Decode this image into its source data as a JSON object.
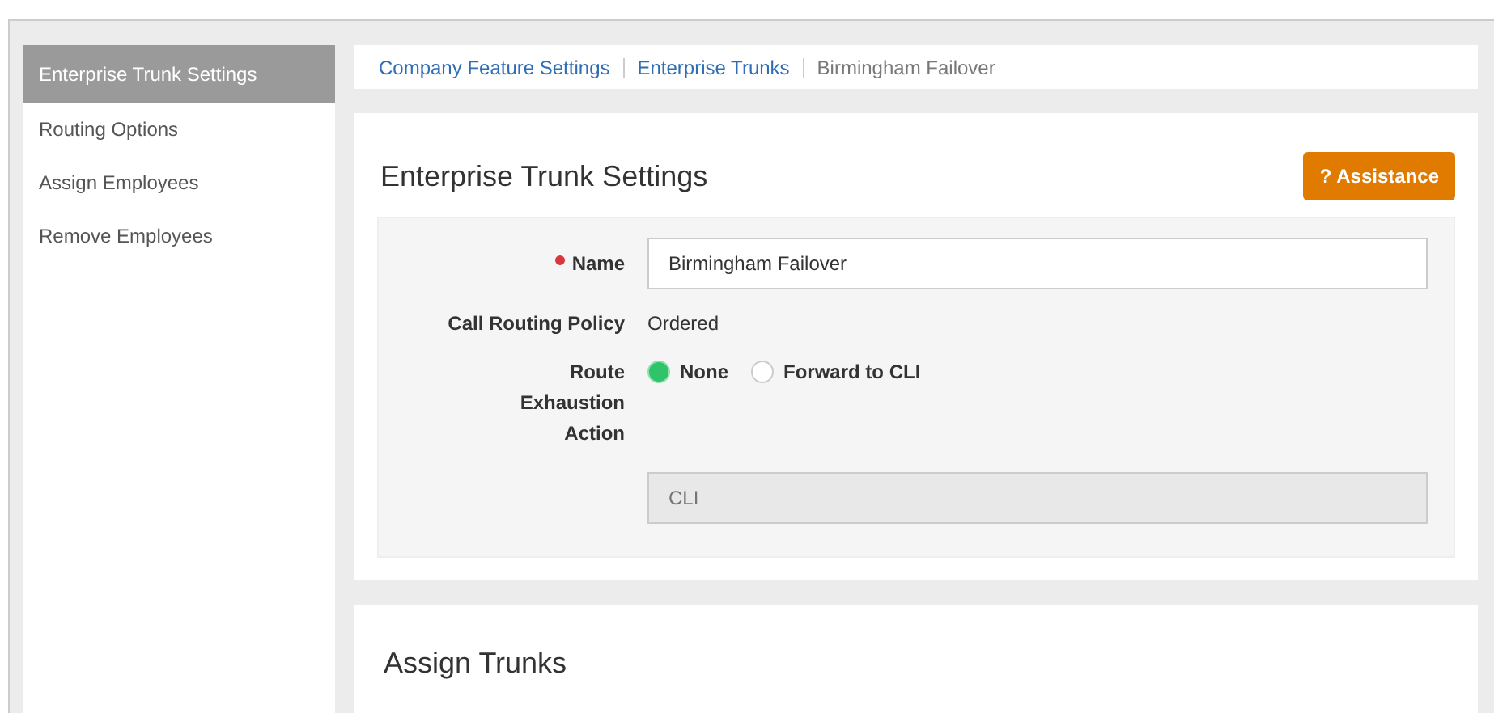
{
  "sidebar": {
    "items": [
      {
        "label": "Enterprise Trunk Settings",
        "selected": true
      },
      {
        "label": "Routing Options",
        "selected": false
      },
      {
        "label": "Assign Employees",
        "selected": false
      },
      {
        "label": "Remove Employees",
        "selected": false
      }
    ]
  },
  "breadcrumb": [
    {
      "label": "Company Feature Settings",
      "kind": "link"
    },
    {
      "label": "Enterprise Trunks",
      "kind": "link"
    },
    {
      "label": "Birmingham Failover",
      "kind": "current"
    }
  ],
  "settings_card": {
    "title": "Enterprise Trunk Settings",
    "assistance_button": "? Assistance",
    "name": {
      "label": "Name",
      "required": true,
      "value": "Birmingham Failover"
    },
    "call_routing_policy": {
      "label": "Call Routing Policy",
      "value": "Ordered"
    },
    "route_exhaustion_action": {
      "label": "Route Exhaustion Action",
      "options": [
        {
          "label": "None",
          "selected": true
        },
        {
          "label": "Forward to CLI",
          "selected": false
        }
      ]
    },
    "cli_field": {
      "placeholder": "CLI",
      "disabled": true
    }
  },
  "assign_trunks_card": {
    "title": "Assign Trunks"
  }
}
